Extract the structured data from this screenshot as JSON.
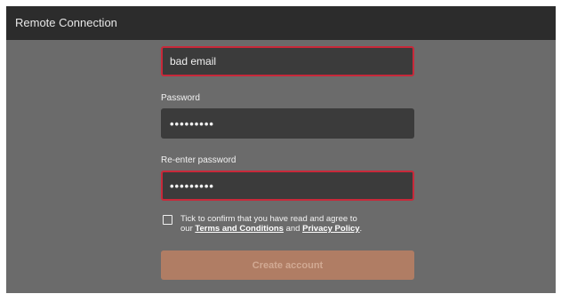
{
  "window": {
    "title": "Remote Connection"
  },
  "form": {
    "email_value": "bad email",
    "password_label": "Password",
    "password_value": "•••••••••",
    "reenter_label": "Re-enter password",
    "reenter_value": "•••••••••",
    "terms_prefix": "Tick to confirm that you have read and agree to",
    "terms_our": "our",
    "terms_link": "Terms and Conditions",
    "terms_and": "and",
    "privacy_link": "Privacy Policy",
    "terms_end": ".",
    "checkbox_checked": false,
    "create_label": "Create account"
  },
  "colors": {
    "error_border": "#c8293a",
    "button_disabled": "#b07d64",
    "background": "#6b6b6b",
    "titlebar": "#2c2c2c"
  }
}
